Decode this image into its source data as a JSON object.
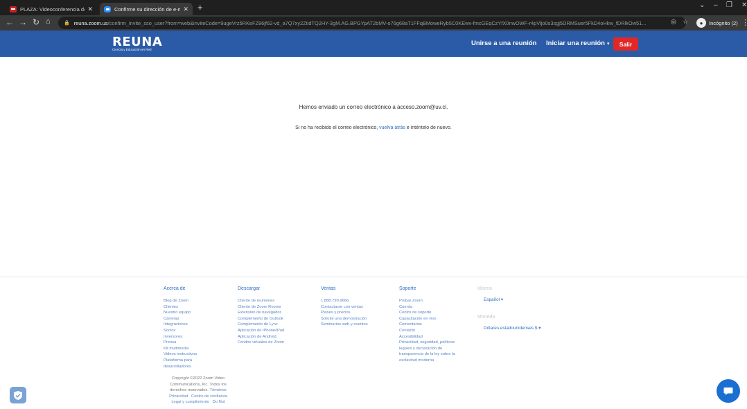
{
  "browser": {
    "tabs": [
      {
        "title": "PLAZA: Videoconferencia de esc"
      },
      {
        "title": "Confirme su dirección de e-mail"
      }
    ],
    "url_host": "reuna.zoom.us",
    "url_path": "/confirm_invite_sso_user?from=web&inviteCode=9ugeVrz5RKeFZ86jf62-vd_a7Q7xy2ZtidTQ2HY-3gM.AG.BPGYpAT2bMV-o76g68aT1FFqBMoweRyb5C0KEwv-fmcGEqCzYfX0nwOWF-r4pVljo0s3sgj5DRMSuer5FkD4oHkw_fDRlkOw51...",
    "incognito_label": "Incógnito (2)"
  },
  "header": {
    "logo_main": "REUNA",
    "logo_sub": "Ciencia y Educación en Red",
    "join_label": "Unirse a una reunión",
    "start_label": "Iniciar una reunión",
    "logout_label": "Salir"
  },
  "main": {
    "message1": "Hemos enviado un correo electrónico a acceso.zoom@uv.cl.",
    "message2_pre": "Si no ha recibido el correo electrónico, ",
    "message2_link": "vuelva atrás",
    "message2_post": " e inténtelo de nuevo."
  },
  "footer": {
    "about": {
      "title": "Acerca de",
      "items": [
        "Blog de Zoom",
        "Clientes",
        "Nuestro equipo",
        "Carreras",
        "Integraciones",
        "Socios",
        "Inversores",
        "Prensa",
        "Kit multimedia",
        "Videos instructivos",
        "Plataforma para",
        "desarrolladores"
      ]
    },
    "download": {
      "title": "Descargar",
      "items": [
        "Cliente de reuniones",
        "Cliente de Zoom Rooms",
        "Extensión de navegador",
        "Complemento de Outlook",
        "Complemento de Lync",
        "Aplicación de iPhone/iPad",
        "Aplicación de Android",
        "Fondos virtuales de Zoom"
      ]
    },
    "sales": {
      "title": "Ventas",
      "items": [
        "1.888.799.9666",
        "Contactarse con ventas",
        "Planes y precios",
        "Solicite una demostración",
        "Seminarios web y eventos"
      ]
    },
    "support": {
      "title": "Soporte",
      "items": [
        "Probar Zoom",
        "Cuenta",
        "Centro de soporte",
        "Capacitación en vivo",
        "Comentarios",
        "Contacto",
        "Accesibilidad",
        "Privacidad, seguridad, políticas",
        "legales y declaración de",
        "transparencia de la ley sobre la",
        "esclavitud moderna"
      ]
    },
    "language": {
      "title": "Idioma",
      "selected": "Español"
    },
    "currency": {
      "title": "Moneda",
      "selected": "Dólares estadounidenses $"
    },
    "copyright_lines": [
      "Copyright ©2022 Zoom Video",
      "Communications, Inc. Todos los"
    ],
    "copyright_line3_pre": "derechos reservados. ",
    "terms_label": "Términos",
    "privacy_label": "Privacidad",
    "trust_label": "Centro de confianza",
    "legal_label": "Legal y cumplimiento",
    "donot_label": "Do Not"
  },
  "colors": {
    "header_bg": "#2b5ba6",
    "logout_bg": "#e02828",
    "link": "#2d6fbf",
    "chat_button": "#1a6fd1"
  }
}
